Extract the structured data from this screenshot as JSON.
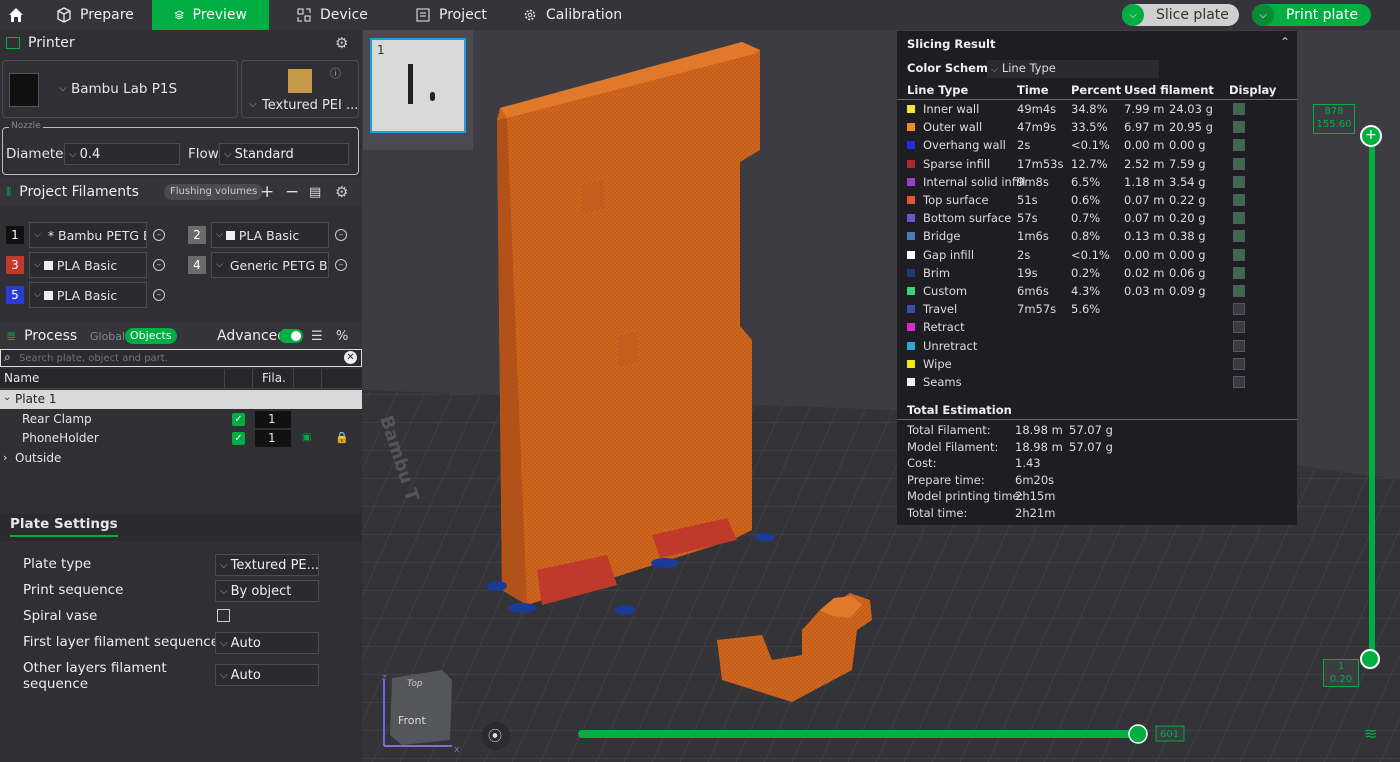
{
  "topbar": {
    "prepare": "Prepare",
    "preview": "Preview",
    "device": "Device",
    "project": "Project",
    "calibration": "Calibration",
    "slice_plate": "Slice plate",
    "print_plate": "Print plate"
  },
  "printer": {
    "title": "Printer",
    "name": "Bambu Lab P1S",
    "plate": "Textured PEI ...",
    "nozzle_label": "Nozzle",
    "diameter_label": "Diameter",
    "diameter": "0.4",
    "flow_label": "Flow",
    "flow": "Standard"
  },
  "filaments": {
    "title": "Project Filaments",
    "flushing": "Flushing volumes",
    "items": [
      {
        "num": "1",
        "name": "* Bambu PETG B...",
        "color": "#111111"
      },
      {
        "num": "2",
        "name": "PLA Basic",
        "color": "#6b6b6b"
      },
      {
        "num": "3",
        "name": "PLA Basic",
        "color": "#c0392b"
      },
      {
        "num": "4",
        "name": "Generic PETG Be...",
        "color": "#6b6b6b"
      },
      {
        "num": "5",
        "name": "PLA Basic",
        "color": "#2a3bd6"
      }
    ]
  },
  "process": {
    "title": "Process",
    "global": "Global",
    "objects": "Objects",
    "advanced": "Advanced",
    "search_placeholder": "Search plate, object and part.",
    "col_name": "Name",
    "col_fila": "Fila.",
    "plate": "Plate 1",
    "rows": [
      {
        "name": "Rear Clamp",
        "fila": "1"
      },
      {
        "name": "PhoneHolder",
        "fila": "1"
      }
    ],
    "outside": "Outside"
  },
  "plate_settings": {
    "title": "Plate Settings",
    "rows": [
      {
        "label": "Plate type",
        "value": "Textured PE..."
      },
      {
        "label": "Print sequence",
        "value": "By object"
      },
      {
        "label": "Spiral vase",
        "value": ""
      },
      {
        "label": "First layer filament sequence",
        "value": "Auto"
      },
      {
        "label": "Other layers filament",
        "label2": "sequence",
        "value": "Auto"
      }
    ]
  },
  "thumb": {
    "num": "1"
  },
  "result": {
    "title": "Slicing Result",
    "scheme_label": "Color Scheme",
    "scheme": "Line Type",
    "cols": [
      "Line Type",
      "Time",
      "Percent",
      "Used filament",
      "Display"
    ],
    "rows": [
      {
        "name": "Inner wall",
        "color": "#f5e33a",
        "time": "49m4s",
        "pct": "34.8%",
        "len": "7.99 m",
        "wt": "24.03 g",
        "on": true
      },
      {
        "name": "Outer wall",
        "color": "#f08a24",
        "time": "47m9s",
        "pct": "33.5%",
        "len": "6.97 m",
        "wt": "20.95 g",
        "on": true
      },
      {
        "name": "Overhang wall",
        "color": "#1a2fe0",
        "time": "2s",
        "pct": "<0.1%",
        "len": "0.00 m",
        "wt": "0.00 g",
        "on": true
      },
      {
        "name": "Sparse infill",
        "color": "#b0262a",
        "time": "17m53s",
        "pct": "12.7%",
        "len": "2.52 m",
        "wt": "7.59 g",
        "on": true
      },
      {
        "name": "Internal solid infill",
        "color": "#9b3fc6",
        "time": "9m8s",
        "pct": "6.5%",
        "len": "1.18 m",
        "wt": "3.54 g",
        "on": true
      },
      {
        "name": "Top surface",
        "color": "#e8533a",
        "time": "51s",
        "pct": "0.6%",
        "len": "0.07 m",
        "wt": "0.22 g",
        "on": true
      },
      {
        "name": "Bottom surface",
        "color": "#6a57c9",
        "time": "57s",
        "pct": "0.7%",
        "len": "0.07 m",
        "wt": "0.20 g",
        "on": true
      },
      {
        "name": "Bridge",
        "color": "#4b7cb8",
        "time": "1m6s",
        "pct": "0.8%",
        "len": "0.13 m",
        "wt": "0.38 g",
        "on": true
      },
      {
        "name": "Gap infill",
        "color": "#ffffff",
        "time": "2s",
        "pct": "<0.1%",
        "len": "0.00 m",
        "wt": "0.00 g",
        "on": true
      },
      {
        "name": "Brim",
        "color": "#1c3a77",
        "time": "19s",
        "pct": "0.2%",
        "len": "0.02 m",
        "wt": "0.06 g",
        "on": true
      },
      {
        "name": "Custom",
        "color": "#3fcf7a",
        "time": "6m6s",
        "pct": "4.3%",
        "len": "0.03 m",
        "wt": "0.09 g",
        "on": true
      },
      {
        "name": "Travel",
        "color": "#3b4fa8",
        "time": "7m57s",
        "pct": "5.6%",
        "len": "",
        "wt": "",
        "on": false
      },
      {
        "name": "Retract",
        "color": "#d82cc8",
        "time": "",
        "pct": "",
        "len": "",
        "wt": "",
        "on": false
      },
      {
        "name": "Unretract",
        "color": "#2aa9d8",
        "time": "",
        "pct": "",
        "len": "",
        "wt": "",
        "on": false
      },
      {
        "name": "Wipe",
        "color": "#f2e51a",
        "time": "",
        "pct": "",
        "len": "",
        "wt": "",
        "on": false
      },
      {
        "name": "Seams",
        "color": "#f0f0f0",
        "time": "",
        "pct": "",
        "len": "",
        "wt": "",
        "on": false
      }
    ],
    "total_title": "Total Estimation",
    "totals": [
      {
        "label": "Total Filament:",
        "v1": "18.98 m",
        "v2": "57.07 g"
      },
      {
        "label": "Model Filament:",
        "v1": "18.98 m",
        "v2": "57.07 g"
      },
      {
        "label": "Cost:",
        "v1": "1.43",
        "v2": ""
      },
      {
        "label": "Prepare time:",
        "v1": "6m20s",
        "v2": ""
      },
      {
        "label": "Model printing time:",
        "v1": "2h15m",
        "v2": ""
      },
      {
        "label": "Total time:",
        "v1": "2h21m",
        "v2": ""
      }
    ]
  },
  "layers": {
    "top_a": "878",
    "top_b": "155.60",
    "bot_a": "1",
    "bot_b": "0.20",
    "h_value": "601"
  },
  "cube": {
    "top": "Top",
    "front": "Front"
  },
  "bed_label": "Bambu T"
}
